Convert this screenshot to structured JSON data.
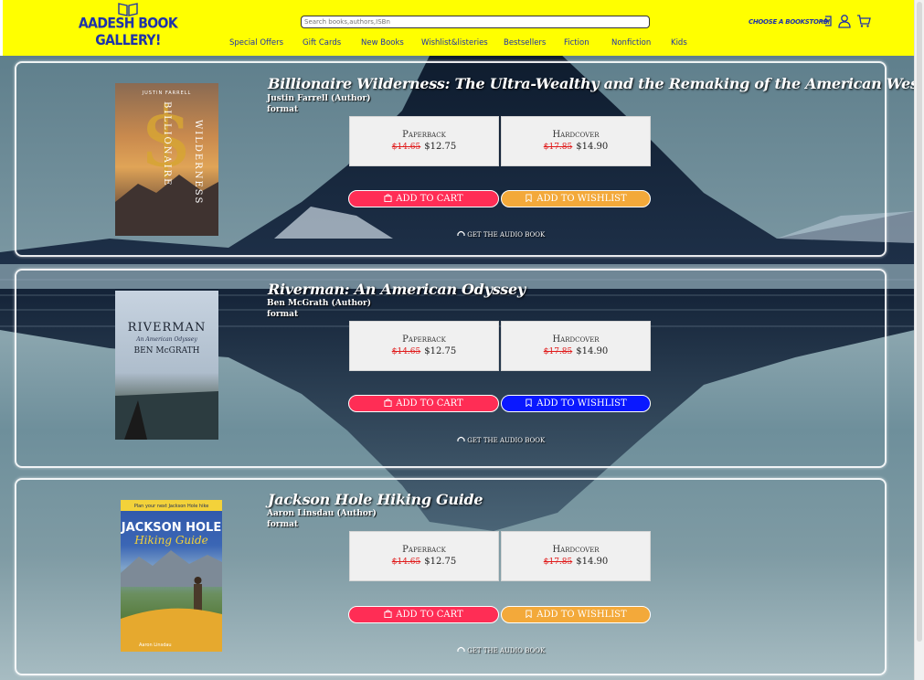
{
  "header": {
    "logo_text": "AADESH BOOK GALLERY!",
    "search_placeholder": "Search books,authors,ISBn",
    "choose_store": "CHOOSE A BOOKSTORE!",
    "icons": [
      "login-icon",
      "user-icon",
      "cart-icon"
    ],
    "nav": [
      "Special Offers",
      "Gift Cards",
      "New Books",
      "Wishlist&listeries",
      "Bestsellers",
      "Fiction",
      "Nonfiction",
      "Kids"
    ]
  },
  "books": [
    {
      "title": "Billionaire Wilderness: The Ultra-Wealthy and the Remaking of the American West",
      "author": "Justin Farrell (Author)",
      "format_label": "format",
      "cover": {
        "author_line": "JUSTIN FARRELL",
        "title_line_1": "BILLIONAIRE",
        "title_line_2": "WILDERNESS"
      },
      "formats": [
        {
          "name": "Paperback",
          "old_price": "$14.65",
          "price": "$12.75"
        },
        {
          "name": "Hardcover",
          "old_price": "$17.85",
          "price": "$14.90"
        }
      ],
      "add_to_cart": "ADD TO CART",
      "add_to_wishlist": "ADD TO WISHLIST",
      "wishlist_active": false,
      "audio_label": "GET THE AUDIO BOOK"
    },
    {
      "title": "Riverman: An American Odyssey",
      "author": "Ben McGrath (Author)",
      "format_label": "format",
      "cover": {
        "title_line": "RIVERMAN",
        "subtitle": "An American Odyssey",
        "author_line": "BEN McGRATH"
      },
      "formats": [
        {
          "name": "Paperback",
          "old_price": "$14.65",
          "price": "$12.75"
        },
        {
          "name": "Hardcover",
          "old_price": "$17.85",
          "price": "$14.90"
        }
      ],
      "add_to_cart": "ADD TO CART",
      "add_to_wishlist": "ADD TO WISHLIST",
      "wishlist_active": true,
      "audio_label": "GET THE AUDIO BOOK"
    },
    {
      "title": "Jackson Hole Hiking Guide",
      "author": "Aaron Linsdau (Author)",
      "format_label": "format",
      "cover": {
        "top_line": "Plan your next Jackson Hole hike",
        "title_line_1": "JACKSON HOLE",
        "title_line_2": "Hiking Guide",
        "author_line": "Aaron Linsdau"
      },
      "formats": [
        {
          "name": "Paperback",
          "old_price": "$14.65",
          "price": "$12.75"
        },
        {
          "name": "Hardcover",
          "old_price": "$17.85",
          "price": "$14.90"
        }
      ],
      "add_to_cart": "ADD TO CART",
      "add_to_wishlist": "ADD TO WISHLIST",
      "wishlist_active": false,
      "audio_label": "GET THE AUDIO BOOK"
    }
  ]
}
